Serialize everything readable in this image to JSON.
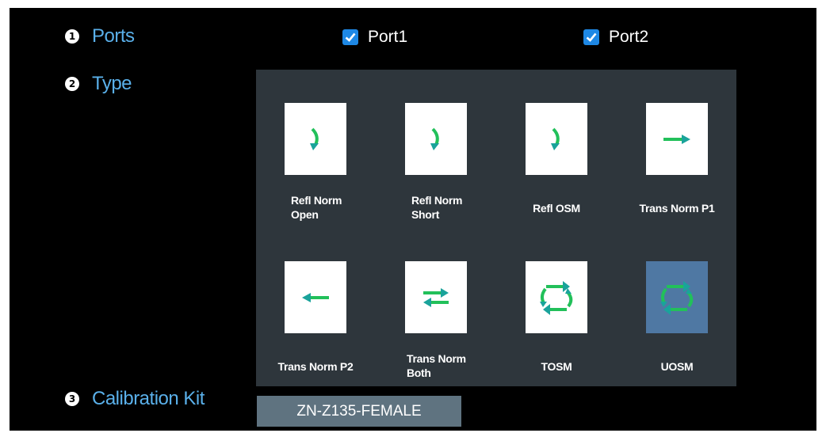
{
  "colors": {
    "background": "#000000",
    "label": "#5ab0ea",
    "panel": "#2e363c",
    "tile": "#ffffff",
    "tile_selected": "#4f78a3",
    "checkbox": "#1e88e5",
    "field": "#5f7380",
    "arrow_green": "#22c05a",
    "arrow_teal": "#1aa39b"
  },
  "sections": [
    {
      "number": "1",
      "label": "Ports"
    },
    {
      "number": "2",
      "label": "Type"
    },
    {
      "number": "3",
      "label": "Calibration Kit"
    }
  ],
  "ports": [
    {
      "label": "Port1",
      "checked": true
    },
    {
      "label": "Port2",
      "checked": true
    }
  ],
  "types": [
    {
      "label": "Refl Norm\nOpen",
      "icon": "refl-norm-open-icon",
      "selected": false
    },
    {
      "label": "Refl Norm\nShort",
      "icon": "refl-norm-short-icon",
      "selected": false
    },
    {
      "label": "Refl OSM",
      "icon": "refl-osm-icon",
      "selected": false
    },
    {
      "label": "Trans Norm P1",
      "icon": "trans-norm-p1-icon",
      "selected": false
    },
    {
      "label": "Trans Norm P2",
      "icon": "trans-norm-p2-icon",
      "selected": false
    },
    {
      "label": "Trans Norm\nBoth",
      "icon": "trans-norm-both-icon",
      "selected": false
    },
    {
      "label": "TOSM",
      "icon": "tosm-icon",
      "selected": false
    },
    {
      "label": "UOSM",
      "icon": "uosm-icon",
      "selected": true
    }
  ],
  "calibration_kit": {
    "value": "ZN-Z135-FEMALE"
  }
}
